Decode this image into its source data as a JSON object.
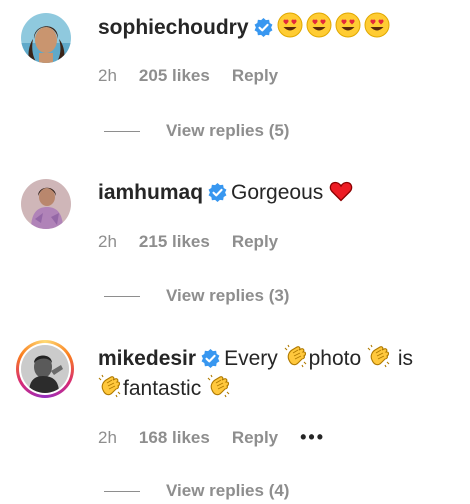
{
  "comments": [
    {
      "username": "sophiechoudry",
      "verified": true,
      "text": "",
      "emojis": [
        "heart-eyes",
        "heart-eyes",
        "heart-eyes",
        "heart-eyes"
      ],
      "time": "2h",
      "likes": "205 likes",
      "reply": "Reply",
      "view_replies": "View replies (5)"
    },
    {
      "username": "iamhumaq",
      "verified": true,
      "text": "Gorgeous",
      "emojis": [
        "red-heart"
      ],
      "time": "2h",
      "likes": "215 likes",
      "reply": "Reply",
      "view_replies": "View replies (3)"
    },
    {
      "username": "mikedesir",
      "verified": true,
      "text_parts": [
        "Every",
        "photo",
        "is",
        "fantastic"
      ],
      "emojis": [
        "clapping-hands"
      ],
      "time": "2h",
      "likes": "168 likes",
      "reply": "Reply",
      "more": "•••",
      "view_replies": "View replies (4)"
    }
  ],
  "colors": {
    "verified_blue": "#3897f0",
    "muted_text": "#8e8e8e",
    "primary_text": "#262626",
    "heart_red": "#ed1c24",
    "emoji_yellow": "#ffcc33"
  }
}
